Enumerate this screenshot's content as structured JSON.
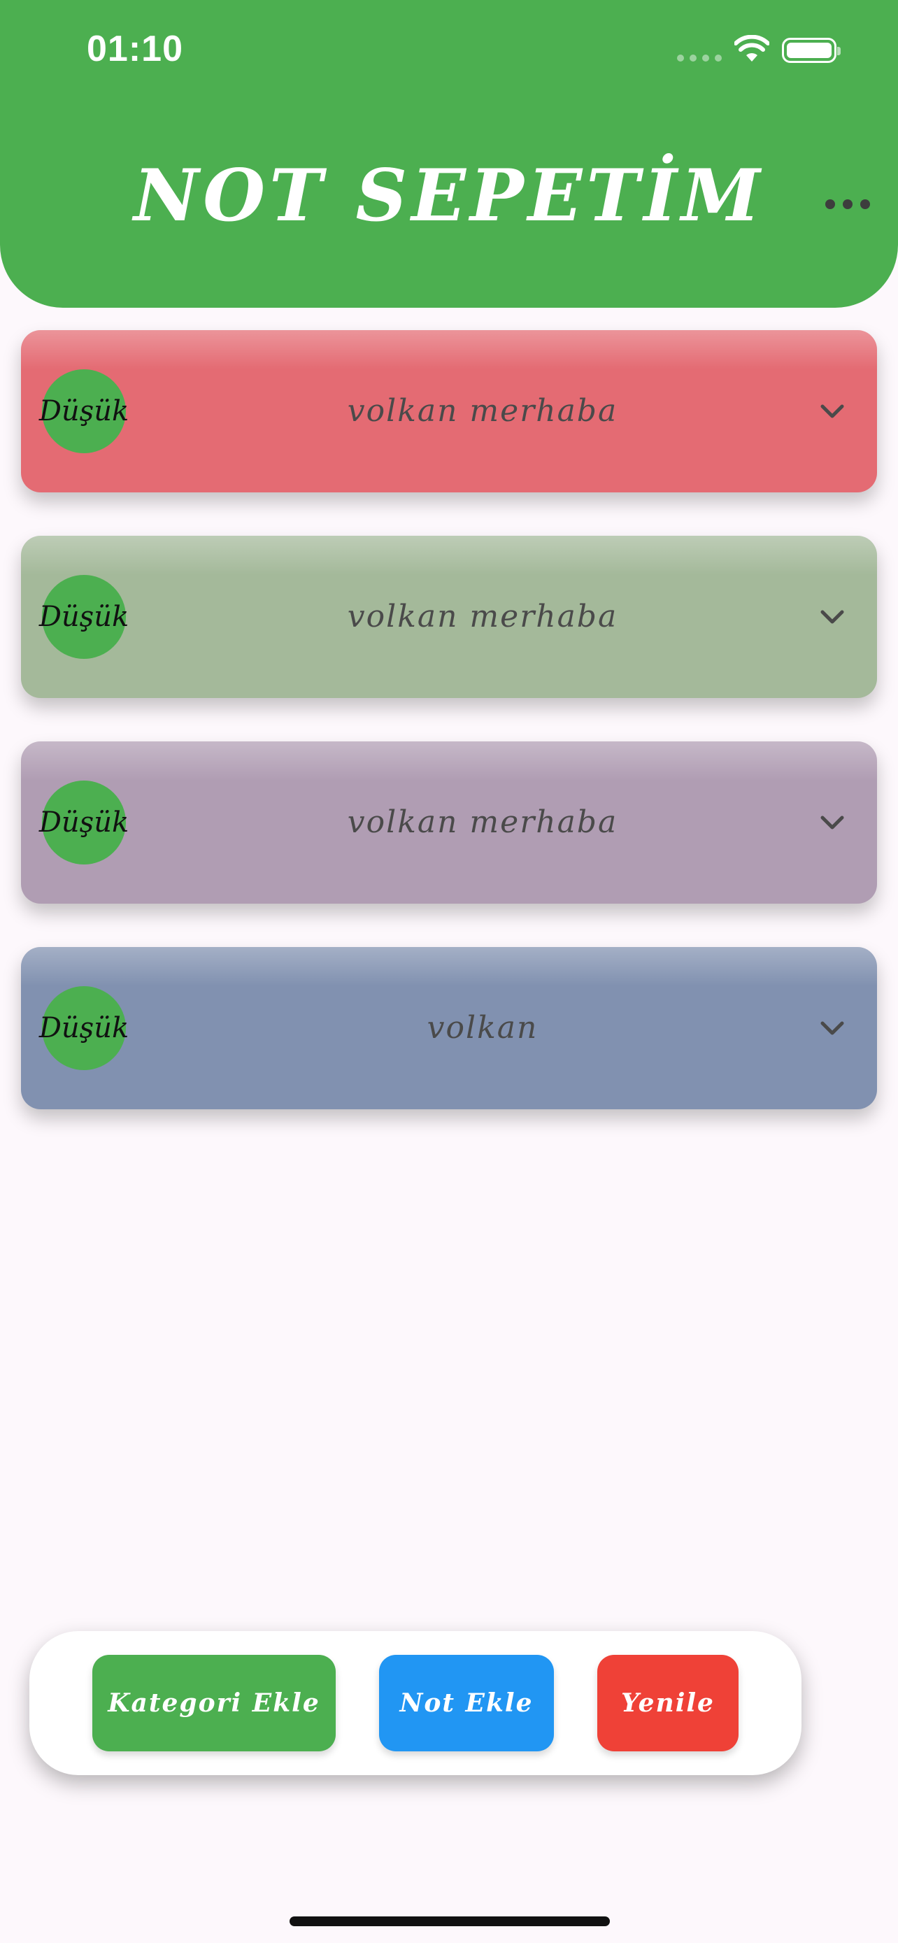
{
  "status_bar": {
    "time": "01:10"
  },
  "header": {
    "title": "NOT SEPETİM",
    "menu_icon": "more-horizontal-icon",
    "color": "#4caf50"
  },
  "notes": [
    {
      "priority": "Düşük",
      "title": "volkan merhaba",
      "color": "#e46b73",
      "expand_icon": "chevron-down-icon"
    },
    {
      "priority": "Düşük",
      "title": "volkan merhaba",
      "color": "#a4b99a",
      "expand_icon": "chevron-down-icon"
    },
    {
      "priority": "Düşük",
      "title": "volkan merhaba",
      "color": "#b09db3",
      "expand_icon": "chevron-down-icon"
    },
    {
      "priority": "Düşük",
      "title": "volkan",
      "color": "#8191b0",
      "expand_icon": "chevron-down-icon"
    }
  ],
  "actions": {
    "add_category": {
      "label": "Kategori Ekle",
      "color": "#4caf50"
    },
    "add_note": {
      "label": "Not Ekle",
      "color": "#2196f3"
    },
    "refresh": {
      "label": "Yenile",
      "color": "#ef4137"
    }
  },
  "background_color": "#fdf8fc"
}
